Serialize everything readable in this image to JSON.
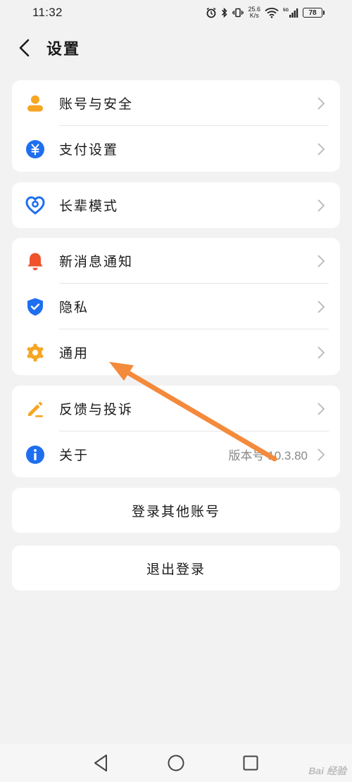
{
  "status_bar": {
    "time": "11:32",
    "net_speed_value": "25.6",
    "net_speed_unit": "K/s",
    "network_type": "5G",
    "battery": "78"
  },
  "header": {
    "title": "设置"
  },
  "groups": [
    {
      "items": [
        {
          "label": "账号与安全",
          "icon": "person-icon",
          "color": "#f5a623"
        },
        {
          "label": "支付设置",
          "icon": "yuan-icon",
          "color": "#1e6ff0"
        }
      ]
    },
    {
      "items": [
        {
          "label": "长辈模式",
          "icon": "heart-icon",
          "color": "#1e6ff0"
        }
      ]
    },
    {
      "items": [
        {
          "label": "新消息通知",
          "icon": "bell-icon",
          "color": "#f0532b"
        },
        {
          "label": "隐私",
          "icon": "shield-icon",
          "color": "#1e6ff0"
        },
        {
          "label": "通用",
          "icon": "gear-icon",
          "color": "#f5a623"
        }
      ]
    },
    {
      "items": [
        {
          "label": "反馈与投诉",
          "icon": "pencil-icon",
          "color": "#f5a623"
        },
        {
          "label": "关于",
          "icon": "info-icon",
          "color": "#1e6ff0",
          "value": "版本号 10.3.80"
        }
      ]
    }
  ],
  "buttons": {
    "switch_account": "登录其他账号",
    "logout": "退出登录"
  },
  "annotation": {
    "color": "#f48a3c"
  },
  "watermark": "Bai 经验"
}
